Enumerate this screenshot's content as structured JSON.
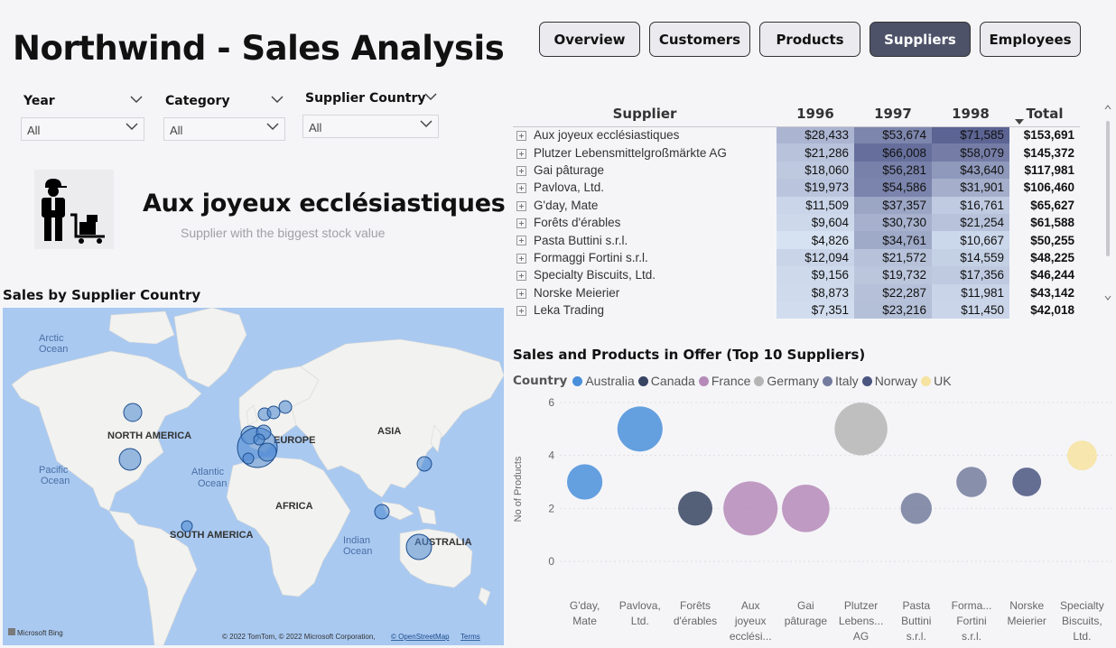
{
  "title": "Northwind - Sales Analysis",
  "nav": [
    {
      "label": "Overview",
      "active": false
    },
    {
      "label": "Customers",
      "active": false
    },
    {
      "label": "Products",
      "active": false
    },
    {
      "label": "Suppliers",
      "active": true
    },
    {
      "label": "Employees",
      "active": false
    }
  ],
  "filters": {
    "year": {
      "label": "Year",
      "value": "All"
    },
    "category": {
      "label": "Category",
      "value": "All"
    },
    "supplier_country": {
      "label": "Supplier Country",
      "value": "All"
    }
  },
  "card": {
    "name": "Aux joyeux ecclésiastiques",
    "subtitle": "Supplier with the biggest stock value",
    "icon": "warehouse-worker-icon"
  },
  "map": {
    "title": "Sales by Supplier Country",
    "labels": {
      "arctic": [
        "Arctic",
        "Ocean"
      ],
      "north_america": "NORTH AMERICA",
      "europe": "EUROPE",
      "asia": "ASIA",
      "pacific": [
        "Pacific",
        "Ocean"
      ],
      "atlantic": [
        "Atlantic",
        "Ocean"
      ],
      "africa": "AFRICA",
      "south_america": "SOUTH AMERICA",
      "indian": [
        "Indian",
        "Ocean"
      ],
      "australia": "AUSTRALIA"
    },
    "bing": "Microsoft Bing",
    "copyright": "© 2022 TomTom, © 2022 Microsoft Corporation,",
    "osm_link": "© OpenStreetMap",
    "terms_link": "Terms",
    "bubble_color": "#4a86d0"
  },
  "matrix": {
    "headers": [
      "Supplier",
      "1996",
      "1997",
      "1998",
      "Total"
    ],
    "rows": [
      {
        "name": "Aux joyeux ecclésiastiques",
        "v": [
          "$28,433",
          "$53,674",
          "$71,585"
        ],
        "total": "$153,691"
      },
      {
        "name": "Plutzer Lebensmittelgroßmärkte AG",
        "v": [
          "$21,286",
          "$66,008",
          "$58,079"
        ],
        "total": "$145,372"
      },
      {
        "name": "Gai pâturage",
        "v": [
          "$18,060",
          "$56,281",
          "$43,640"
        ],
        "total": "$117,981"
      },
      {
        "name": "Pavlova, Ltd.",
        "v": [
          "$19,973",
          "$54,586",
          "$31,901"
        ],
        "total": "$106,460"
      },
      {
        "name": "G'day, Mate",
        "v": [
          "$11,509",
          "$37,357",
          "$16,761"
        ],
        "total": "$65,627"
      },
      {
        "name": "Forêts d'érables",
        "v": [
          "$9,604",
          "$30,730",
          "$21,254"
        ],
        "total": "$61,588"
      },
      {
        "name": "Pasta Buttini s.r.l.",
        "v": [
          "$4,826",
          "$34,761",
          "$10,667"
        ],
        "total": "$50,255"
      },
      {
        "name": "Formaggi Fortini s.r.l.",
        "v": [
          "$12,094",
          "$21,572",
          "$14,559"
        ],
        "total": "$48,225"
      },
      {
        "name": "Specialty Biscuits, Ltd.",
        "v": [
          "$9,156",
          "$19,732",
          "$17,356"
        ],
        "total": "$46,244"
      },
      {
        "name": "Norske Meierier",
        "v": [
          "$8,873",
          "$22,287",
          "$11,981"
        ],
        "total": "$43,142"
      },
      {
        "name": "Leka Trading",
        "v": [
          "$7,351",
          "$23,216",
          "$11,450"
        ],
        "total": "$42,018"
      }
    ]
  },
  "chart_data": {
    "type": "scatter",
    "title": "Sales and Products in Offer (Top 10 Suppliers)",
    "ylabel": "No of Products",
    "ylim": [
      0,
      6
    ],
    "yticks": [
      "0",
      "2",
      "4",
      "6"
    ],
    "legend_title": "Country",
    "legend_position": "top-left",
    "legend": [
      {
        "name": "Australia",
        "color": "#4a8fdb"
      },
      {
        "name": "Canada",
        "color": "#374462"
      },
      {
        "name": "France",
        "color": "#b58ab8"
      },
      {
        "name": "Germany",
        "color": "#b5b5b5"
      },
      {
        "name": "Italy",
        "color": "#737c9e"
      },
      {
        "name": "Norway",
        "color": "#4a5580"
      },
      {
        "name": "UK",
        "color": "#f7e3a0"
      }
    ],
    "categories": [
      [
        "G'day,",
        "Mate"
      ],
      [
        "Pavlova,",
        "Ltd."
      ],
      [
        "Forêts",
        "d'érables"
      ],
      [
        "Aux",
        "joyeux",
        "ecclési..."
      ],
      [
        "Gai",
        "pâturage"
      ],
      [
        "Plutzer",
        "Lebens...",
        "AG"
      ],
      [
        "Pasta",
        "Buttini",
        "s.r.l."
      ],
      [
        "Forma...",
        "Fortini",
        "s.r.l."
      ],
      [
        "Norske",
        "Meierier"
      ],
      [
        "Specialty",
        "Biscuits,",
        "Ltd."
      ]
    ],
    "points": [
      {
        "y": 3,
        "country": "Australia",
        "sales": 65627
      },
      {
        "y": 5,
        "country": "Australia",
        "sales": 106460
      },
      {
        "y": 2,
        "country": "Canada",
        "sales": 61588
      },
      {
        "y": 2,
        "country": "France",
        "sales": 153691
      },
      {
        "y": 2,
        "country": "France",
        "sales": 117981
      },
      {
        "y": 5,
        "country": "Germany",
        "sales": 145372
      },
      {
        "y": 2,
        "country": "Italy",
        "sales": 50255
      },
      {
        "y": 3,
        "country": "Italy",
        "sales": 48225
      },
      {
        "y": 3,
        "country": "Norway",
        "sales": 43142
      },
      {
        "y": 4,
        "country": "UK",
        "sales": 46244
      }
    ]
  }
}
